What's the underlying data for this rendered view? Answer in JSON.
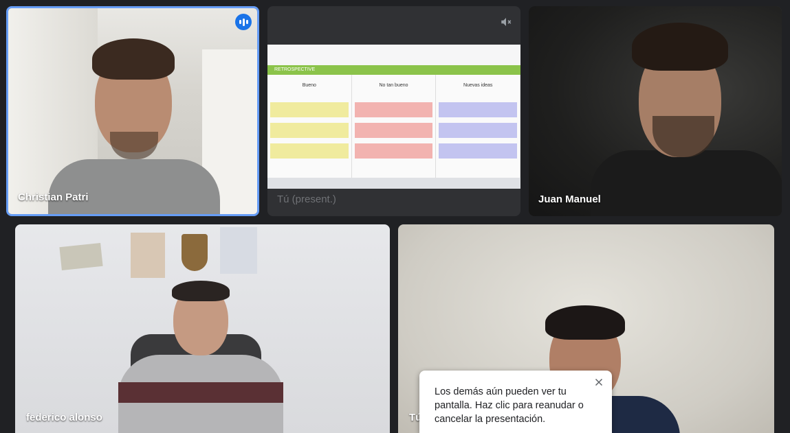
{
  "participants": [
    {
      "name": "Christian Patri",
      "speaking": true
    },
    {
      "name": "Tú (present.)",
      "muted": true
    },
    {
      "name": "Juan Manuel"
    },
    {
      "name": "federico alonso"
    },
    {
      "name": "Tú"
    }
  ],
  "shared_screen": {
    "title": "RETROSPECTIVE",
    "columns": [
      "Bueno",
      "No tan bueno",
      "Nuevas ideas"
    ]
  },
  "popup": {
    "message": "Los demás aún pueden ver tu pantalla. Haz clic para reanudar o cancelar la presentación."
  },
  "colors": {
    "background": "#202124",
    "active_speaker_border": "#669df6",
    "speaking_badge": "#1a73e8"
  }
}
